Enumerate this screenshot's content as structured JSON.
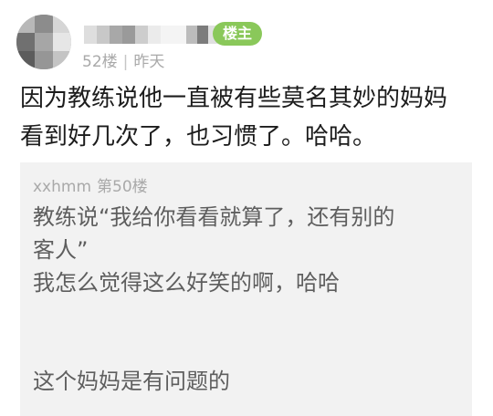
{
  "post": {
    "badge": "楼主",
    "floor": "52楼",
    "separator": "|",
    "time": "昨天",
    "content_lines": [
      "因为教练说他一直被有些莫名其妙的妈妈",
      "看到好几次了，也习惯了。哈哈。"
    ]
  },
  "quote": {
    "username": "xxhmm",
    "floor": "第50楼",
    "lines": [
      "教练说“我给你看看就算了，还有别的",
      "客人”",
      "我怎么觉得这么好笑的啊，哈哈"
    ],
    "last_line": "这个妈妈是有问题的"
  },
  "colors": {
    "badge_bg": "#8ac85a",
    "meta_text": "#a9a9a9",
    "quote_bg": "#f2f2f2",
    "quote_text": "#5e5e5e",
    "content_text": "#1c1c1c"
  }
}
